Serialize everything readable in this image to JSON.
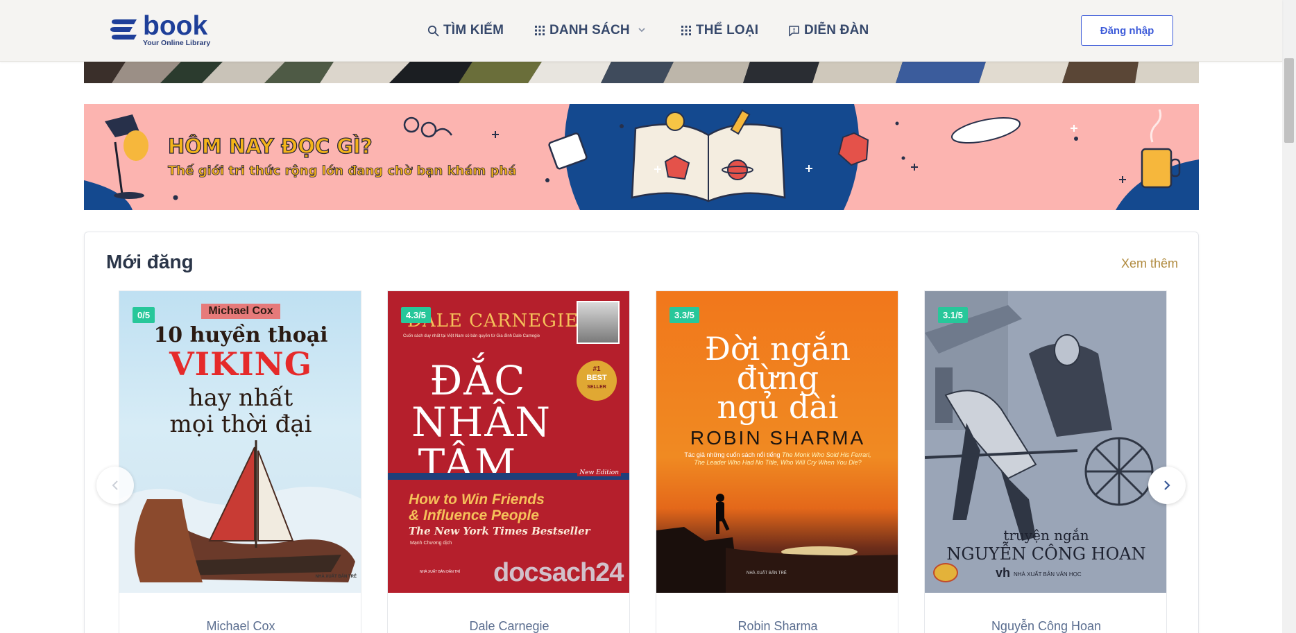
{
  "header": {
    "logo_word": "book",
    "logo_tagline": "Your Online Library",
    "nav": [
      {
        "label": "TÌM KIẾM",
        "icon": "search-icon"
      },
      {
        "label": "DANH SÁCH",
        "icon": "grid-icon",
        "has_dropdown": true
      },
      {
        "label": "THỂ LOẠI",
        "icon": "grid-icon"
      },
      {
        "label": "DIỄN ĐÀN",
        "icon": "chat-icon"
      }
    ],
    "login_label": "Đăng nhập"
  },
  "banner": {
    "title": "HÔM NAY ĐỌC GÌ?",
    "subtitle": "Thế giới tri thức rộng lớn đang chờ bạn khám phá"
  },
  "section": {
    "title": "Mới đăng",
    "see_more": "Xem thêm",
    "books": [
      {
        "rating": "0/5",
        "author": "Michael Cox",
        "cover": {
          "author_tag": "Michael Cox",
          "line1": "10 huyền thoại",
          "line2": "VIKING",
          "line3": "hay nhất",
          "line4": "mọi thời đại",
          "publisher": "NHÀ XUẤT BẢN TRẺ"
        }
      },
      {
        "rating": "4.3/5",
        "author": "Dale Carnegie",
        "cover": {
          "author_tag": "DALE CARNEGIE",
          "tagline": "Cuốn sách duy nhất tại Việt Nam có bản quyền từ Gia đình Dale Carnegie",
          "line1": "ĐẮC",
          "line2": "NHÂN",
          "line3": "TÂM",
          "edition": "New Edition",
          "en1": "How to Win Friends",
          "en2": "& Influence People",
          "en3": "The New York Times Bestseller",
          "translator": "Mạnh Chương dịch",
          "watermark": "docsach24",
          "badge1": "#1",
          "badge2": "BEST",
          "badge3": "SELLER",
          "publisher": "NHÀ XUẤT BẢN DÂN TRÍ"
        }
      },
      {
        "rating": "3.3/5",
        "author": "Robin Sharma",
        "cover": {
          "line1": "Đời ngắn",
          "line2": "đừng",
          "line3": "ngủ dài",
          "author_tag": "ROBIN SHARMA",
          "tagline_a": "Tác giả những cuốn sách nổi tiếng",
          "tagline_b": "The Monk Who Sold His Ferrari, The Leader Who Had No Title, Who Will Cry When You Die?",
          "publisher": "NHÀ XUẤT BẢN TRẺ"
        }
      },
      {
        "rating": "3.1/5",
        "author": "Nguyễn Công Hoan",
        "cover": {
          "line1": "truyện ngắn",
          "line2": "NGUYỄN CÔNG HOAN",
          "publisher": "NHÀ XUẤT BẢN VĂN HỌC",
          "pub_mark": "vh"
        }
      }
    ]
  },
  "colors": {
    "brand": "#1e3f99",
    "rating_badge": "#27c79a",
    "see_more": "#b08a3e",
    "banner_bg": "#fcb4b0",
    "login_border": "#3d5bd9"
  }
}
